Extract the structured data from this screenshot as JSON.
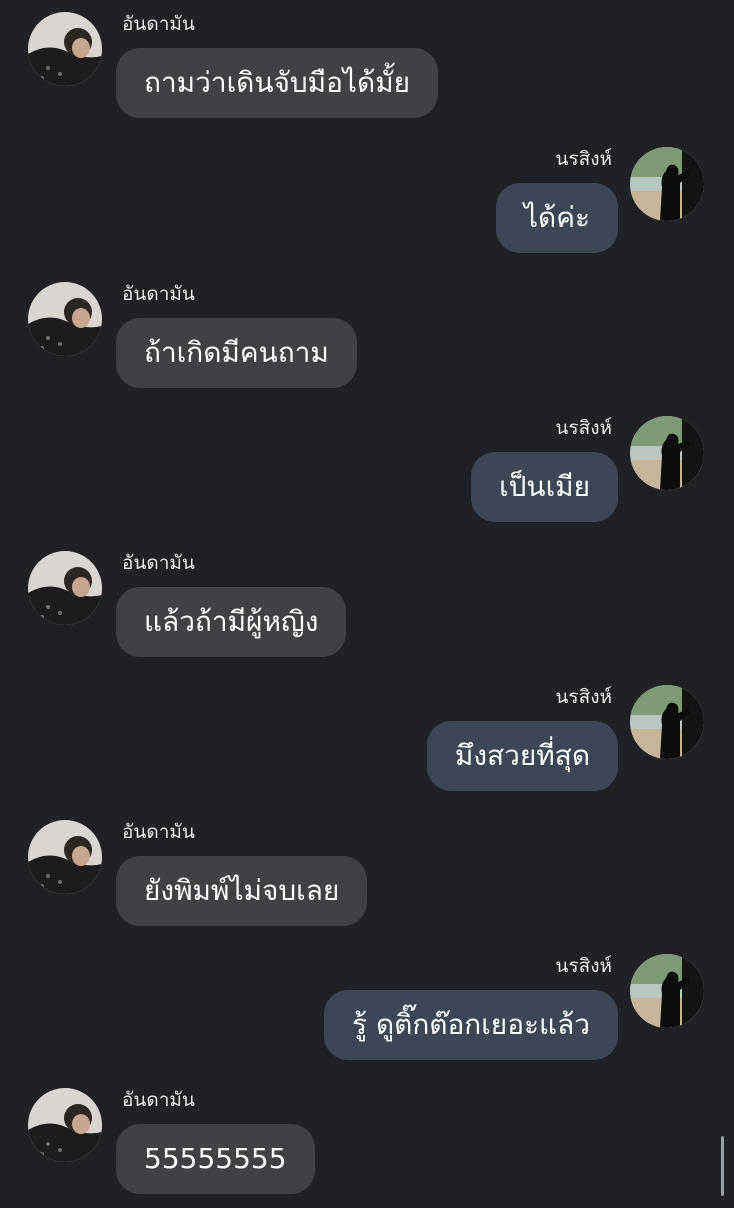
{
  "conversation": {
    "messages": [
      {
        "sender": "อันดามัน",
        "text": "ถามว่าเดินจับมือได้มั้ย",
        "side": "left"
      },
      {
        "sender": "นรสิงห์",
        "text": "ได้ค่ะ",
        "side": "right"
      },
      {
        "sender": "อันดามัน",
        "text": "ถ้าเกิดมีคนถาม",
        "side": "left"
      },
      {
        "sender": "นรสิงห์",
        "text": "เป็นเมีย",
        "side": "right"
      },
      {
        "sender": "อันดามัน",
        "text": "แล้วถ้ามีผู้หญิง",
        "side": "left"
      },
      {
        "sender": "นรสิงห์",
        "text": "มึงสวยที่สุด",
        "side": "right"
      },
      {
        "sender": "อันดามัน",
        "text": "ยังพิมพ์ไม่จบเลย",
        "side": "left"
      },
      {
        "sender": "นรสิงห์",
        "text": "รู้ ดูติ๊กต๊อกเยอะแล้ว",
        "side": "right"
      },
      {
        "sender": "อันดามัน",
        "text": "55555555",
        "side": "left"
      }
    ]
  },
  "colors": {
    "background": "#202125",
    "incoming_bubble": "#404045",
    "outgoing_bubble": "#3d4656",
    "text": "#ffffff"
  },
  "icons": {
    "incoming_avatar": "person-lying-avatar-icon",
    "outgoing_avatar": "silhouette-by-window-avatar-icon",
    "scrollbar": "scrollbar-thumb"
  }
}
